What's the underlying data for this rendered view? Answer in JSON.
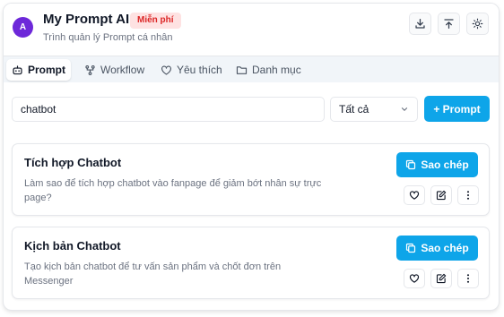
{
  "app": {
    "avatar_letter": "A",
    "title": "My Prompt AI",
    "plan_badge": "Miễn phí",
    "subtitle": "Trình quản lý Prompt cá nhân"
  },
  "header_actions": [
    {
      "icon": "download-icon"
    },
    {
      "icon": "upload-icon"
    },
    {
      "icon": "sun-icon"
    }
  ],
  "tabs": [
    {
      "label": "Prompt",
      "icon": "robot-icon",
      "active": true
    },
    {
      "label": "Workflow",
      "icon": "workflow-icon",
      "active": false
    },
    {
      "label": "Yêu thích",
      "icon": "heart-icon",
      "active": false
    },
    {
      "label": "Danh mục",
      "icon": "folder-icon",
      "active": false
    }
  ],
  "search": {
    "value": "chatbot",
    "placeholder": ""
  },
  "filter": {
    "selected": "Tất cả"
  },
  "add_button": {
    "label": "+ Prompt"
  },
  "prompts": [
    {
      "title": "Tích hợp Chatbot",
      "description": "Làm sao để tích hợp chatbot vào fanpage để giảm bớt nhân sự trực page?",
      "copy_label": "Sao chép"
    },
    {
      "title": "Kịch bản Chatbot",
      "description": "Tạo kịch bản chatbot để tư vấn sản phẩm và chốt đơn trên Messenger",
      "copy_label": "Sao chép"
    }
  ],
  "colors": {
    "accent": "#0ea5e9",
    "avatar": "#6d28d9",
    "badge_bg": "#fee2e2",
    "badge_text": "#dc2626"
  }
}
